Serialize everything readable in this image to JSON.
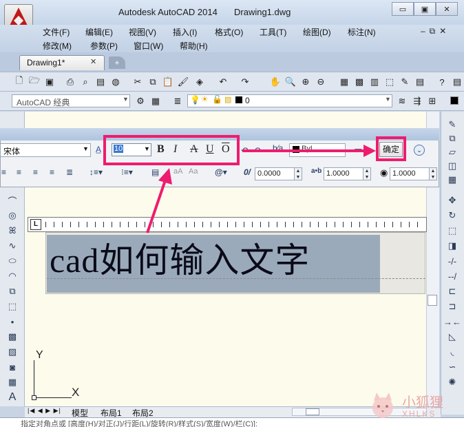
{
  "window": {
    "app_title": "Autodesk AutoCAD 2014",
    "doc_title": "Drawing1.dwg",
    "minimize": "▭",
    "restore": "▣",
    "close": "✕"
  },
  "menus": {
    "row1": [
      "文件(F)",
      "编辑(E)",
      "视图(V)",
      "插入(I)",
      "格式(O)",
      "工具(T)",
      "绘图(D)",
      "标注(N)"
    ],
    "row2": [
      "修改(M)",
      "参数(P)",
      "窗口(W)",
      "帮助(H)"
    ],
    "mdi_controls": "–⧉✕"
  },
  "tabs": {
    "doc_tab": "Drawing1*",
    "doc_tab_close": "✕",
    "new_tab": "+"
  },
  "toolbar2": {
    "workspace": "AutoCAD 经典",
    "layer": "0"
  },
  "text_format": {
    "font": "宋体",
    "size": "10",
    "bold": "B",
    "italic": "I",
    "strikethrough": "A",
    "underline": "U",
    "overline": "O",
    "color": "ByL",
    "ok_label": "确定",
    "oblique": "0.0000",
    "tracking": "1.0000",
    "width_factor": "1.0000",
    "oblique_prefix": "0/",
    "tracking_prefix": "a•b",
    "symbol": "@▾"
  },
  "editor": {
    "text": "cad如何输入文字",
    "ruler_corner": "L"
  },
  "ucs": {
    "y_label": "Y",
    "x_label": "X"
  },
  "layout_tabs": {
    "nav": "|◀ ◀ ▶ ▶|",
    "model": "模型",
    "layout1": "布局1",
    "layout2": "布局2"
  },
  "command_line": {
    "prompt": "指定对角点或 [高度(H)/对正(J)/行距(L)/旋转(R)/样式(S)/宽度(W)/栏(C)]:"
  },
  "watermark": {
    "title": "小狐狸",
    "subtitle": "XHLKS"
  },
  "colors": {
    "highlight": "#ee1c6e",
    "drawing_bg": "#fdfbec",
    "selection": "#9aaabb"
  }
}
